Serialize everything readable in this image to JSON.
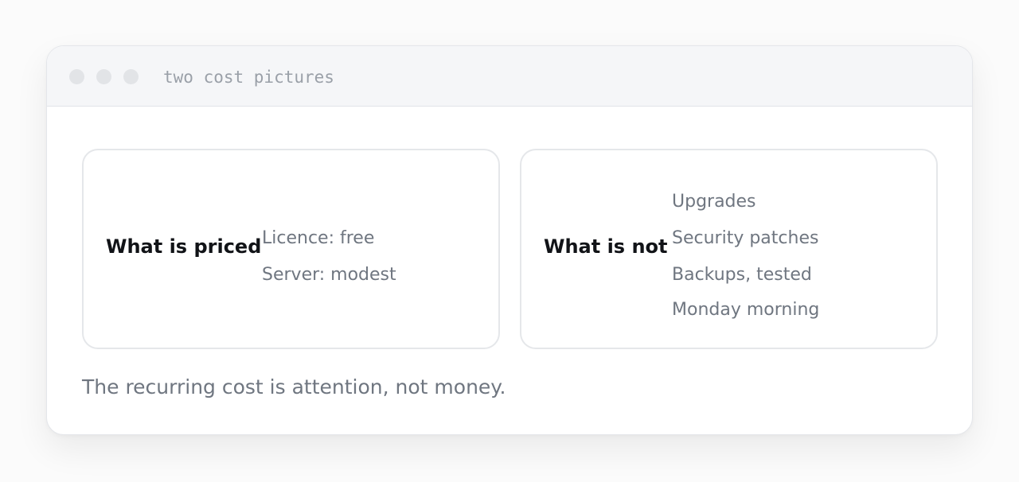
{
  "window": {
    "title": "two cost pictures"
  },
  "cards": {
    "priced": {
      "label": "What is priced",
      "items": [
        "Licence: free",
        "Server: modest"
      ]
    },
    "not_priced": {
      "label": "What is not",
      "items": [
        "Upgrades",
        "Security patches",
        "Backups, tested",
        "Monday morning"
      ]
    }
  },
  "footer": {
    "note": "The recurring cost is attention, not money."
  },
  "colors": {
    "window_bg": "#ffffff",
    "titlebar_bg": "#f5f6f8",
    "dot": "#e2e4e7",
    "text_muted": "#6f7680",
    "text_strong": "#111317",
    "border": "#e5e7ea"
  }
}
